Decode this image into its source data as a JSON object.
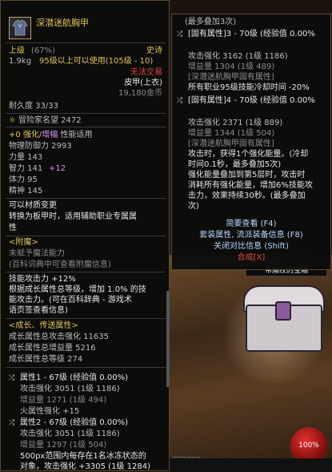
{
  "item": {
    "name": "深潜迷航胸甲",
    "grade": "上级",
    "grade_pct": "(67%)",
    "rarity": "史诗",
    "weight": "1.9kg",
    "usable_level": "95级以上可以使用(105级 - 10)",
    "trade": "无法交易",
    "type": "皮甲(上衣)",
    "price": "19,180金币",
    "durability": "耐久度 33/33",
    "adventure": "冒险家名望 2472",
    "enhance_line_a": "+0 强化/",
    "enhance_line_b": "增幅",
    "enhance_line_c": " 性能适用",
    "stats": [
      "物理防御力 2993",
      "力量 143",
      "智力 141",
      "体力 95",
      "精神 145"
    ],
    "int_bonus": "+12",
    "material_1": "可以材质变更",
    "material_2": "转换为板甲时，适用辅助职业专属属",
    "material_3": "性",
    "enchant_header": "<附魔>",
    "enchant_1": "未赋予魔法能力",
    "enchant_2": "(百科词典中可查看附魔信息)",
    "skill_1": "技能攻击力 +12%",
    "skill_2": "根据成长属性总等级，增加 1.0% 的技",
    "skill_3": "能攻击力。(可在百科辞典 - 游戏术",
    "skill_4": "语页签查看信息)",
    "growth_header": "<成长、传送属性>",
    "growth_1": "成长属性总攻击强化 11635",
    "growth_2": "成长属性总增益量 5216",
    "growth_3": "成长属性总等级 274",
    "attr1_title": "属性1 - 67级 (经验值 0.00%)",
    "attr1_atk": "攻击强化 3051 (1级 1186)",
    "attr1_buff": "增益量 1271 (1级 494)",
    "fire": "火属性强化 +15",
    "attr2_title": "属性2 - 67级 (经验值 0.00%)",
    "attr2_atk": "攻击强化 3051 (1级 1186)",
    "attr2_buff": "增益量 1297 (1级 504)",
    "bottom_1": "500px范围内每存在1名冰冻状态的",
    "bottom_2": "对象，攻击强化 +3305 (1级 1284)"
  },
  "right": {
    "max_stack": "(最多叠加3次)",
    "attr3_title": "[固有属性]3 - 70级 (经验值 0.00%",
    "attr3_atk": "攻击强化 3162 (1级 1186)",
    "attr3_buff": "增益量 1304 (1级 489)",
    "set_tag": "[深潜迷航胸甲固有属性]",
    "cd_line": "所有职业95级技能冷却时间 -20%",
    "attr4_title": "[固有属性]4 - 70级 (经验值 0.00%",
    "attr4_atk": "攻击强化 2371 (1级 889)",
    "attr4_buff": "增益量 1344 (1级 504)",
    "set_tag2": "[深潜迷航胸甲固有属性]",
    "desc_1": "攻击时，获得1个强化能量。(冷却",
    "desc_2": "时间0.1秒，最多叠加5次)",
    "desc_3": "强化能量叠加到第5层时，攻击时",
    "desc_4": "消耗所有强化能量，增加6%技能攻",
    "desc_5": "击力，效果持续30秒。(最多叠加",
    "desc_6": "次)",
    "btn_brief": "简要查看 (F4)",
    "btn_set": "套装属性, 流派装备信息 (F8)",
    "btn_compare": "关闭对比信息 (Shift)",
    "btn_combine": "合成[X]"
  },
  "scene": {
    "chest_label": "带魔纹的宝箱",
    "orb_value": "100%"
  },
  "colors": {
    "gold": "#e0c25c",
    "epic": "#e0c25c",
    "red": "#e04a3a",
    "purple": "#d58cf4",
    "blue": "#6fa8ff"
  }
}
